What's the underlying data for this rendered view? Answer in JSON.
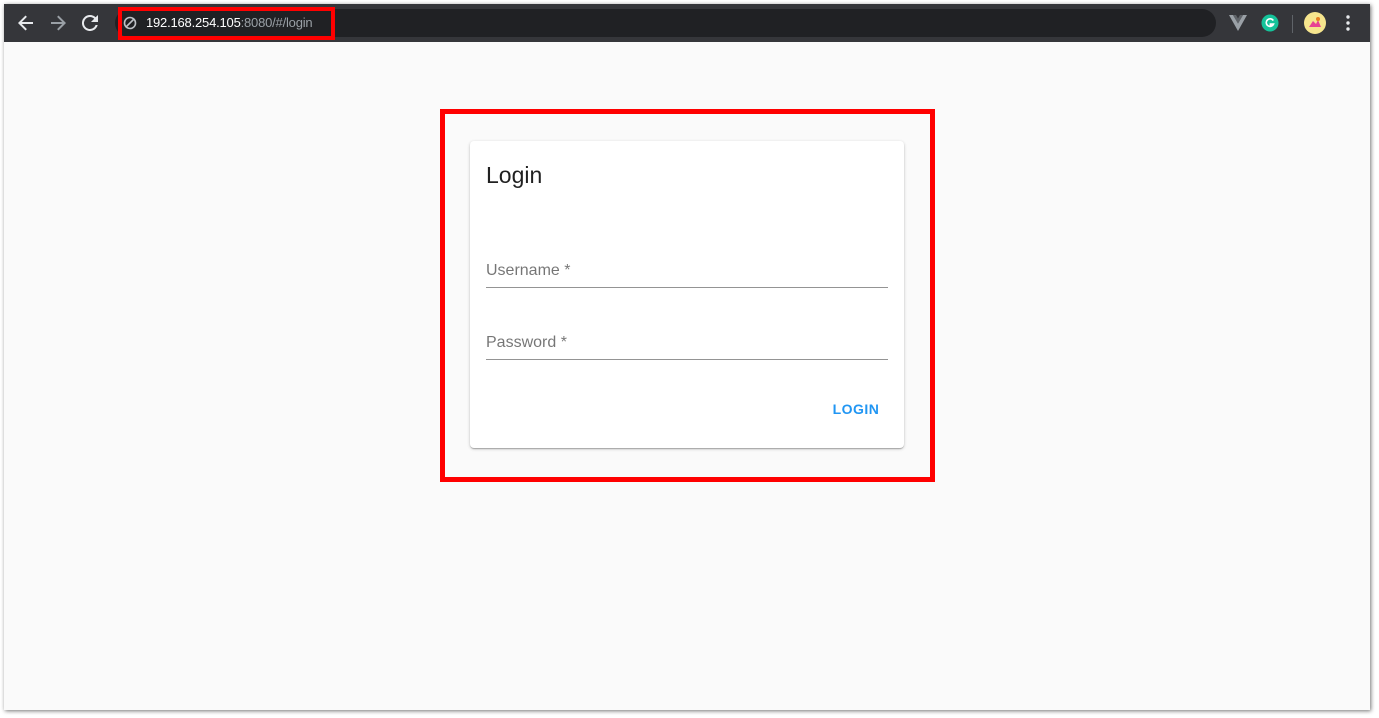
{
  "browser": {
    "url_host": "192.168.254.105",
    "url_path": ":8080/#/login",
    "icons": {
      "back": "arrow-left-icon",
      "forward": "arrow-right-icon",
      "reload": "reload-icon",
      "security": "not-secure-icon",
      "extension_vue": "vue-devtools-icon",
      "extension_grammarly": "grammarly-icon",
      "profile": "profile-avatar-icon",
      "menu": "kebab-menu-icon"
    }
  },
  "login_card": {
    "title": "Login",
    "username_label": "Username *",
    "password_label": "Password *",
    "login_button": "LOGIN"
  },
  "colors": {
    "highlight": "#ff0000",
    "accent": "#2196f3",
    "toolbar": "#35363a",
    "page_background": "#fafafa"
  }
}
